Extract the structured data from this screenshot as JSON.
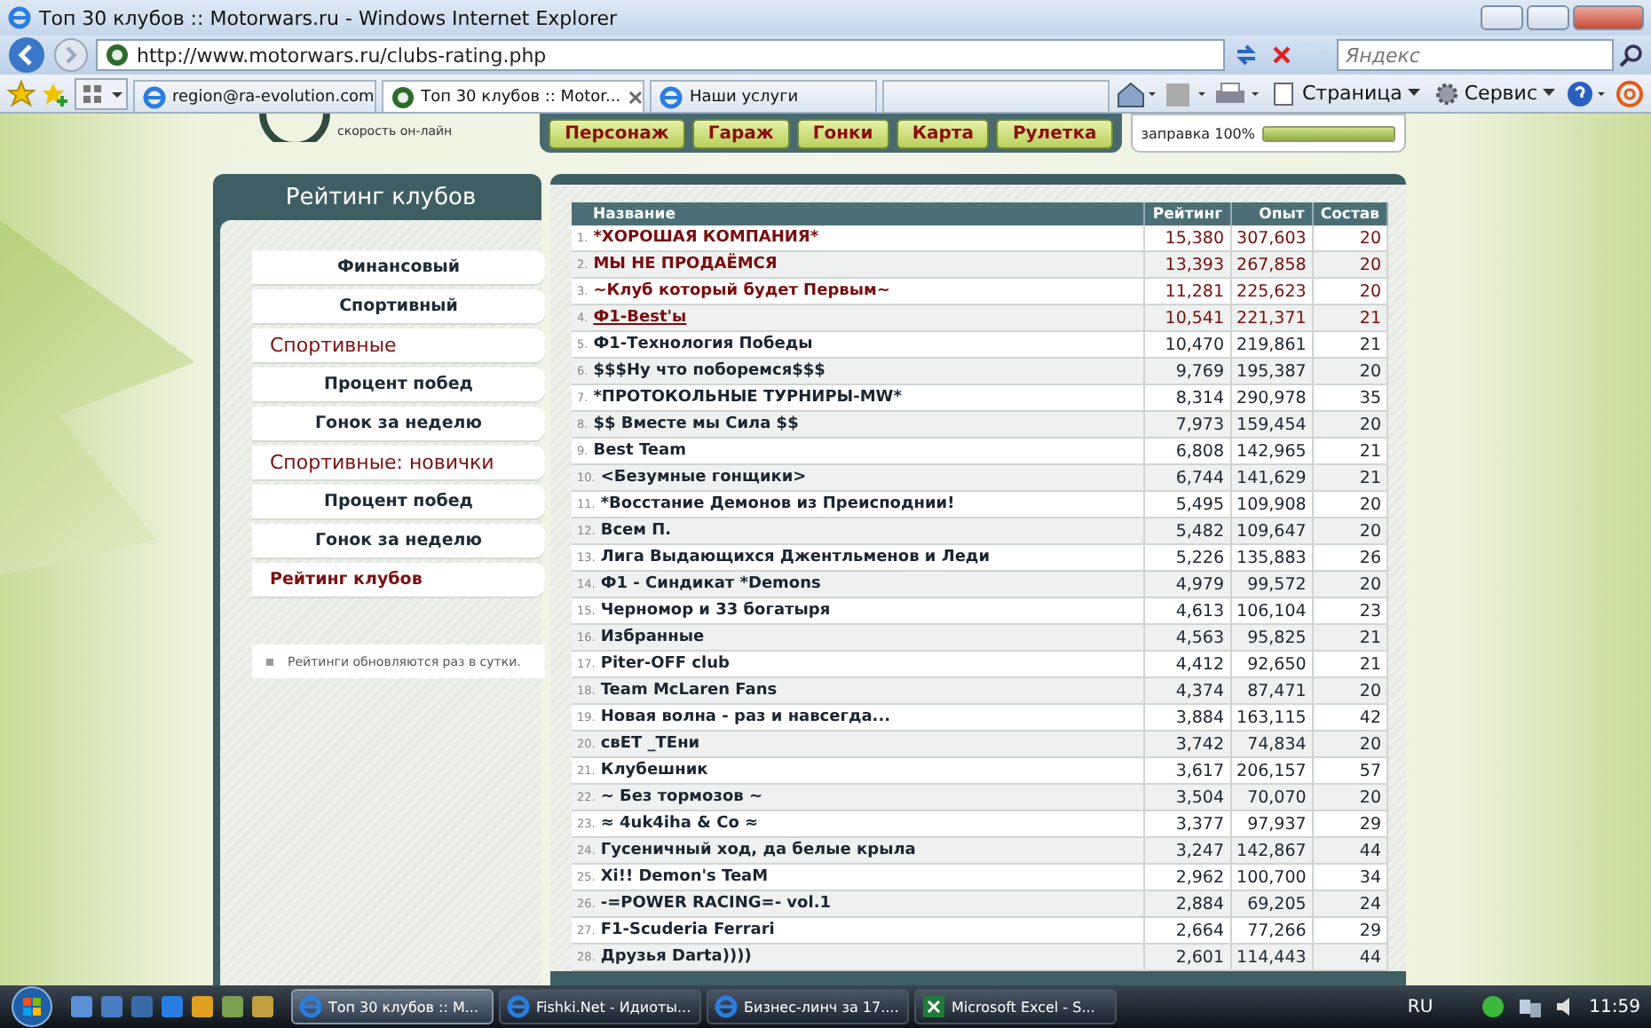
{
  "window": {
    "title": "Топ 30 клубов :: Motorwars.ru - Windows Internet Explorer"
  },
  "address_bar": {
    "url": "http://www.motorwars.ru/clubs-rating.php"
  },
  "search": {
    "placeholder": "Яндекс"
  },
  "tabs": [
    {
      "label": "region@ra-evolution.com",
      "selected": false
    },
    {
      "label": "Топ 30 клубов :: Motor...",
      "selected": true
    },
    {
      "label": "Наши услуги",
      "selected": false
    }
  ],
  "command_bar": {
    "items": [
      "Страница",
      "Сервис"
    ]
  },
  "site": {
    "tagline": "скорость он-лайн",
    "nav": [
      "Персонаж",
      "Гараж",
      "Гонки",
      "Карта",
      "Рулетка"
    ],
    "fuel": {
      "label": "заправка 100%",
      "level": 1.0
    }
  },
  "sidebar": {
    "title": "Рейтинг клубов",
    "items": [
      {
        "label": "Финансовый",
        "kind": "link"
      },
      {
        "label": "Спортивный",
        "kind": "link"
      },
      {
        "label": "Спортивные",
        "kind": "heading"
      },
      {
        "label": "Процент побед",
        "kind": "link"
      },
      {
        "label": "Гонок за неделю",
        "kind": "link"
      },
      {
        "label": "Спортивные: новички",
        "kind": "heading"
      },
      {
        "label": "Процент побед",
        "kind": "link"
      },
      {
        "label": "Гонок за неделю",
        "kind": "link"
      },
      {
        "label": "Рейтинг клубов",
        "kind": "current"
      }
    ],
    "note": "Рейтинги обновляются раз в сутки."
  },
  "table": {
    "columns": [
      "Название",
      "Рейтинг",
      "Опыт",
      "Состав"
    ],
    "rows": [
      {
        "rank": "1.",
        "name": "*ХОРОШАЯ КОМПАНИЯ*",
        "rating": "15,380",
        "experience": "307,603",
        "members": "20",
        "kind": "leader"
      },
      {
        "rank": "2.",
        "name": "МЫ НЕ ПРОДАЁМСЯ",
        "rating": "13,393",
        "experience": "267,858",
        "members": "20",
        "kind": "leader"
      },
      {
        "rank": "3.",
        "name": "~Клуб который будет Первым~",
        "rating": "11,281",
        "experience": "225,623",
        "members": "20",
        "kind": "leader"
      },
      {
        "rank": "4.",
        "name": "Ф1-Best'ы",
        "rating": "10,541",
        "experience": "221,371",
        "members": "21",
        "kind": "hovered"
      },
      {
        "rank": "5.",
        "name": "Ф1-Технология Победы",
        "rating": "10,470",
        "experience": "219,861",
        "members": "21",
        "kind": "normal"
      },
      {
        "rank": "6.",
        "name": "$$$Ну что поборемся$$$",
        "rating": "9,769",
        "experience": "195,387",
        "members": "20",
        "kind": "normal"
      },
      {
        "rank": "7.",
        "name": "*ПРОТОКОЛЬНЫЕ ТУРНИРЫ-MW*",
        "rating": "8,314",
        "experience": "290,978",
        "members": "35",
        "kind": "normal"
      },
      {
        "rank": "8.",
        "name": "$$ Вместе мы Сила $$",
        "rating": "7,973",
        "experience": "159,454",
        "members": "20",
        "kind": "normal"
      },
      {
        "rank": "9.",
        "name": "Best Team",
        "rating": "6,808",
        "experience": "142,965",
        "members": "21",
        "kind": "normal"
      },
      {
        "rank": "10.",
        "name": "<Безумные гонщики>",
        "rating": "6,744",
        "experience": "141,629",
        "members": "21",
        "kind": "normal"
      },
      {
        "rank": "11.",
        "name": "*Восстание Демонов из Преисподнии!",
        "rating": "5,495",
        "experience": "109,908",
        "members": "20",
        "kind": "normal"
      },
      {
        "rank": "12.",
        "name": "Всем П.",
        "rating": "5,482",
        "experience": "109,647",
        "members": "20",
        "kind": "normal"
      },
      {
        "rank": "13.",
        "name": "Лига Выдающихся Джентльменов и Леди",
        "rating": "5,226",
        "experience": "135,883",
        "members": "26",
        "kind": "normal"
      },
      {
        "rank": "14.",
        "name": "Ф1 - Синдикат *Demons",
        "rating": "4,979",
        "experience": "99,572",
        "members": "20",
        "kind": "normal"
      },
      {
        "rank": "15.",
        "name": "Черномор и 33 богатыря",
        "rating": "4,613",
        "experience": "106,104",
        "members": "23",
        "kind": "normal"
      },
      {
        "rank": "16.",
        "name": "Избранные",
        "rating": "4,563",
        "experience": "95,825",
        "members": "21",
        "kind": "normal"
      },
      {
        "rank": "17.",
        "name": "Piter-OFF club",
        "rating": "4,412",
        "experience": "92,650",
        "members": "21",
        "kind": "normal"
      },
      {
        "rank": "18.",
        "name": "Team McLaren Fans",
        "rating": "4,374",
        "experience": "87,471",
        "members": "20",
        "kind": "normal"
      },
      {
        "rank": "19.",
        "name": "Новая волна - раз и навсегда...",
        "rating": "3,884",
        "experience": "163,115",
        "members": "42",
        "kind": "normal"
      },
      {
        "rank": "20.",
        "name": "свЕТ _ТЕни",
        "rating": "3,742",
        "experience": "74,834",
        "members": "20",
        "kind": "normal"
      },
      {
        "rank": "21.",
        "name": "Клубешник",
        "rating": "3,617",
        "experience": "206,157",
        "members": "57",
        "kind": "normal"
      },
      {
        "rank": "22.",
        "name": "~ Без тормозов ~",
        "rating": "3,504",
        "experience": "70,070",
        "members": "20",
        "kind": "normal"
      },
      {
        "rank": "23.",
        "name": "≈ 4uk4iha & Co ≈",
        "rating": "3,377",
        "experience": "97,937",
        "members": "29",
        "kind": "normal"
      },
      {
        "rank": "24.",
        "name": "Гусеничный ход, да белые крыла",
        "rating": "3,247",
        "experience": "142,867",
        "members": "44",
        "kind": "normal"
      },
      {
        "rank": "25.",
        "name": "Xi!! Demon's TeaM",
        "rating": "2,962",
        "experience": "100,700",
        "members": "34",
        "kind": "normal"
      },
      {
        "rank": "26.",
        "name": "-=POWER RACING=- vol.1",
        "rating": "2,884",
        "experience": "69,205",
        "members": "24",
        "kind": "normal"
      },
      {
        "rank": "27.",
        "name": "F1-Scuderia Ferrari",
        "rating": "2,664",
        "experience": "77,266",
        "members": "29",
        "kind": "normal"
      },
      {
        "rank": "28.",
        "name": "Друзья Darta))))",
        "rating": "2,601",
        "experience": "114,443",
        "members": "44",
        "kind": "normal"
      }
    ]
  },
  "taskbar": {
    "tasks": [
      {
        "label": "Топ 30 клубов :: М...",
        "selected": true
      },
      {
        "label": "Fishki.Net - Идиоты...",
        "selected": false
      },
      {
        "label": "Бизнес-линч за 17....",
        "selected": false
      },
      {
        "label": "Microsoft Excel - S...",
        "selected": false
      }
    ],
    "language": "RU",
    "clock": "11:59"
  }
}
